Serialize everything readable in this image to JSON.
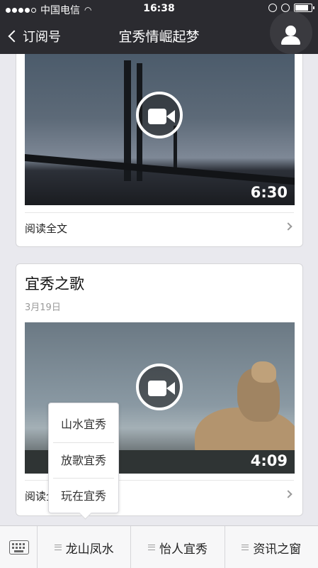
{
  "status_bar": {
    "carrier": "中国电信",
    "time": "16:38"
  },
  "nav": {
    "back_label": "订阅号",
    "title": "宜秀情崛起梦"
  },
  "articles": [
    {
      "title": "",
      "date": "",
      "video_duration": "6:30",
      "read_more": "阅读全文"
    },
    {
      "title": "宜秀之歌",
      "date": "3月19日",
      "video_duration": "4:09",
      "read_more": "阅读全文"
    }
  ],
  "popup_menu": {
    "items": [
      "山水宜秀",
      "放歌宜秀",
      "玩在宜秀"
    ]
  },
  "bottom_menu": {
    "tabs": [
      "龙山凤水",
      "怡人宜秀",
      "资讯之窗"
    ]
  }
}
